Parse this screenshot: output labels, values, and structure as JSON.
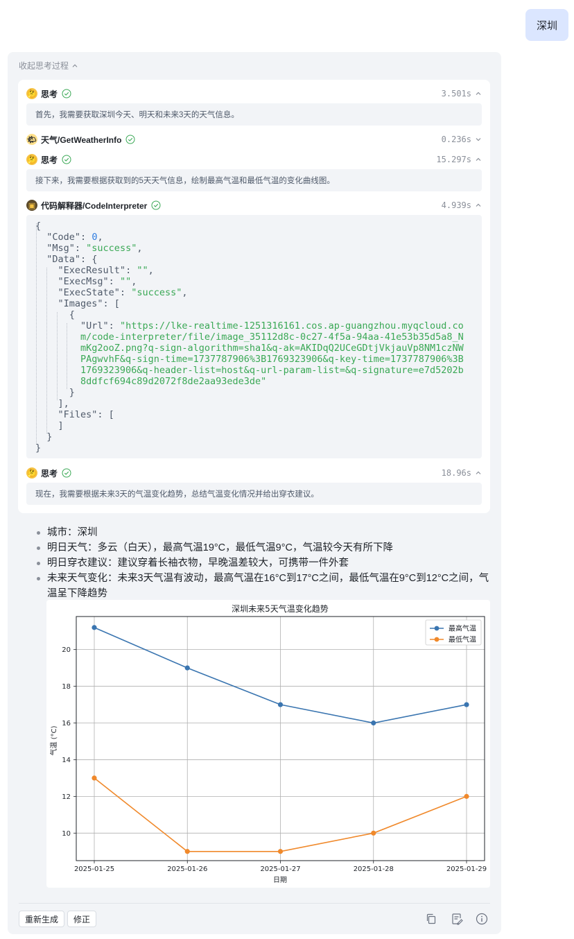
{
  "user_message": "深圳",
  "collapse_label": "收起思考过程",
  "steps": [
    {
      "title": "思考",
      "time": "3.501s",
      "body": "首先，我需要获取深圳今天、明天和未来3天的天气信息。"
    },
    {
      "title": "天气/GetWeatherInfo",
      "time": "0.236s"
    },
    {
      "title": "思考",
      "time": "15.297s",
      "body": "接下来，我需要根据获取到的5天天气信息，绘制最高气温和最低气温的变化曲线图。"
    },
    {
      "title": "代码解释器/CodeInterpreter",
      "time": "4.939s"
    },
    {
      "title": "思考",
      "time": "18.96s",
      "body": "现在，我需要根据未来3天的气温变化趋势，总结气温变化情况并给出穿衣建议。"
    }
  ],
  "code": {
    "open_brace": "{",
    "code_key": "\"Code\"",
    "code_value": "0",
    "msg_key": "\"Msg\"",
    "msg_value": "\"success\"",
    "data_key": "\"Data\"",
    "execresult_key": "\"ExecResult\"",
    "execresult_value": "\"\"",
    "execmsg_key": "\"ExecMsg\"",
    "execmsg_value": "\"\"",
    "execstate_key": "\"ExecState\"",
    "execstate_value": "\"success\"",
    "images_key": "\"Images\"",
    "url_key": "\"Url\"",
    "url_lines": [
      "\"https://lke-realtime-1251316161.cos.ap-guangzhou.myqcloud.co",
      "m/code-interpreter/file/image_35112d8c-0c27-4f5a-94aa-41e53b35d5a8_N",
      "mKg2ooZ.png?q-sign-algorithm=sha1&q-ak=AKIDqQ2UCeGDtjVkjauVp8NM1czNW",
      "PAgwvhF&q-sign-time=1737787906%3B1769323906&q-key-time=1737787906%3B",
      "1769323906&q-header-list=host&q-url-param-list=&q-signature=e7d5202b",
      "8ddfcf694c89d2072f8de2aa93ede3de\""
    ],
    "files_key": "\"Files\""
  },
  "answer_items": [
    "城市：深圳",
    "明日天气：多云（白天），最高气温19°C，最低气温9°C，气温较今天有所下降",
    "明日穿衣建议：建议穿着长袖衣物，早晚温差较大，可携带一件外套",
    "未来天气变化：未来3天气温有波动，最高气温在16°C到17°C之间，最低气温在9°C到12°C之间，气温呈下降趋势"
  ],
  "chart_data": {
    "type": "line",
    "title": "深圳未来5天气温变化趋势",
    "xlabel": "日期",
    "ylabel": "气温 (°C)",
    "categories": [
      "2025-01-25",
      "2025-01-26",
      "2025-01-27",
      "2025-01-28",
      "2025-01-29"
    ],
    "series": [
      {
        "name": "最高气温",
        "values": [
          21.2,
          19,
          17,
          16,
          17
        ],
        "color": "#3a75b0"
      },
      {
        "name": "最低气温",
        "values": [
          13,
          9,
          9,
          10,
          12
        ],
        "color": "#f0892b"
      }
    ],
    "yticks": [
      10,
      12,
      14,
      16,
      18,
      20
    ],
    "ylim": [
      8.5,
      21.8
    ],
    "grid": true,
    "legend": "top-right"
  },
  "footer": {
    "regenerate_label": "重新生成",
    "correct_label": "修正"
  }
}
